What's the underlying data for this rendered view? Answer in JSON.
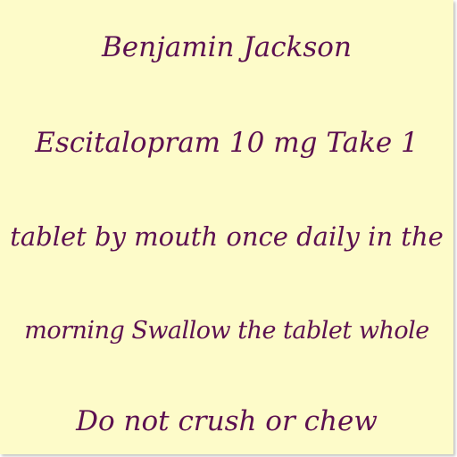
{
  "note": {
    "lines": [
      "Benjamin Jackson",
      "Escitalopram 10 mg Take 1",
      "tablet by mouth once daily in the",
      "morning Swallow the tablet whole",
      "Do not crush or chew"
    ],
    "colors": {
      "paper": "#fdfbc9",
      "ink": "#5c1050"
    }
  }
}
